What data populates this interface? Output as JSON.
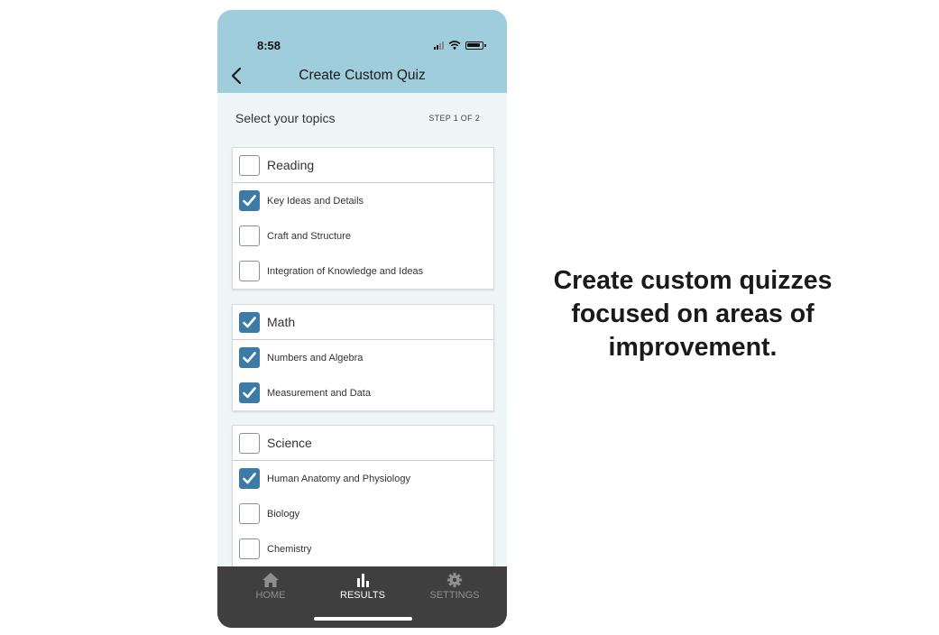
{
  "status_bar": {
    "time": "8:58"
  },
  "header": {
    "title": "Create Custom Quiz"
  },
  "section": {
    "title": "Select your topics",
    "step": "STEP 1 OF 2"
  },
  "groups": [
    {
      "label": "Reading",
      "checked": false,
      "items": [
        {
          "label": "Key Ideas and Details",
          "checked": true
        },
        {
          "label": "Craft and Structure",
          "checked": false
        },
        {
          "label": "Integration of Knowledge and Ideas",
          "checked": false
        }
      ]
    },
    {
      "label": "Math",
      "checked": true,
      "items": [
        {
          "label": "Numbers and Algebra",
          "checked": true
        },
        {
          "label": "Measurement and Data",
          "checked": true
        }
      ]
    },
    {
      "label": "Science",
      "checked": false,
      "items": [
        {
          "label": "Human Anatomy and Physiology",
          "checked": true
        },
        {
          "label": "Biology",
          "checked": false
        },
        {
          "label": "Chemistry",
          "checked": false
        }
      ]
    }
  ],
  "tabs": [
    {
      "label": "HOME",
      "icon": "home-icon",
      "active": false
    },
    {
      "label": "RESULTS",
      "icon": "bar-chart-icon",
      "active": true
    },
    {
      "label": "SETTINGS",
      "icon": "gear-icon",
      "active": false
    }
  ],
  "promo": {
    "text": "Create custom quizzes focused on areas of improvement."
  },
  "colors": {
    "header_bg": "#9fcddc",
    "checkbox_checked": "#3c7ba8",
    "tabbar_bg": "#3f3f3f",
    "content_bg": "#eff6f8"
  }
}
